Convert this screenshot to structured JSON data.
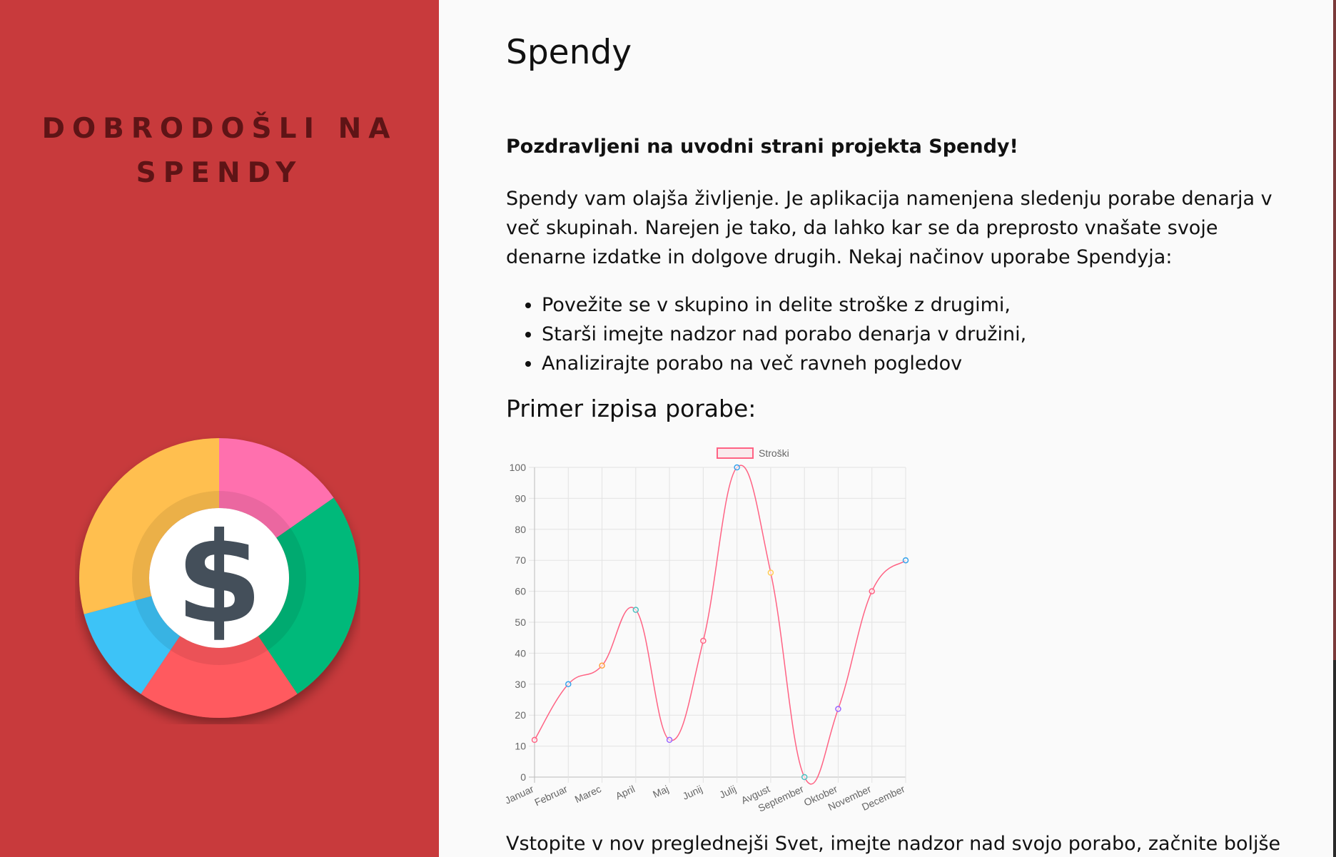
{
  "sidebar": {
    "welcome_line1": "DOBRODOŠLI NA",
    "welcome_line2": "SPENDY",
    "accent_color": "#c83a3c",
    "logo": {
      "icon": "dollar-icon",
      "symbol": "$",
      "segment_colors": [
        "#ff6fae",
        "#00b97a",
        "#ff5a5f",
        "#3ec3f7",
        "#ffbf4f"
      ]
    }
  },
  "main": {
    "title": "Spendy",
    "intro_bold": "Pozdravljeni na uvodni strani projekta Spendy!",
    "paragraph": "Spendy vam olajša življenje. Je aplikacija namenjena sledenju porabe denarja v več skupinah. Narejen je tako, da lahko kar se da preprosto vnašate svoje denarne izdatke in dolgove drugih. Nekaj načinov uporabe Spendyja:",
    "bullets": [
      "Povežite se v skupino in delite stroške z drugimi,",
      "Starši imejte nadzor nad porabo denarja v družini,",
      "Analizirajte porabo na več ravneh pogledov"
    ],
    "chart_heading": "Primer izpisa porabe:",
    "outro": "Vstopite v nov preglednejši Svet, imejte nadzor nad svojo porabo, začnite boljše"
  },
  "chart_data": {
    "type": "line",
    "categories": [
      "Januar",
      "Februar",
      "Marec",
      "April",
      "Maj",
      "Junij",
      "Julij",
      "Avgust",
      "September",
      "Oktober",
      "November",
      "December"
    ],
    "series": [
      {
        "name": "Stroški",
        "values": [
          12,
          30,
          36,
          54,
          12,
          44,
          100,
          66,
          0,
          22,
          60,
          70
        ],
        "color": "#ff6384"
      }
    ],
    "point_colors": [
      "#ff6384",
      "#36a2eb",
      "#ff9f40",
      "#4bc0c0",
      "#9966ff",
      "#ff6384",
      "#36a2eb",
      "#ffcd56",
      "#4bc0c0",
      "#9966ff",
      "#ff6384",
      "#36a2eb"
    ],
    "yticks": [
      0,
      10,
      20,
      30,
      40,
      50,
      60,
      70,
      80,
      90,
      100
    ],
    "ylim": [
      0,
      100
    ],
    "grid": true,
    "legend": "top-center"
  }
}
